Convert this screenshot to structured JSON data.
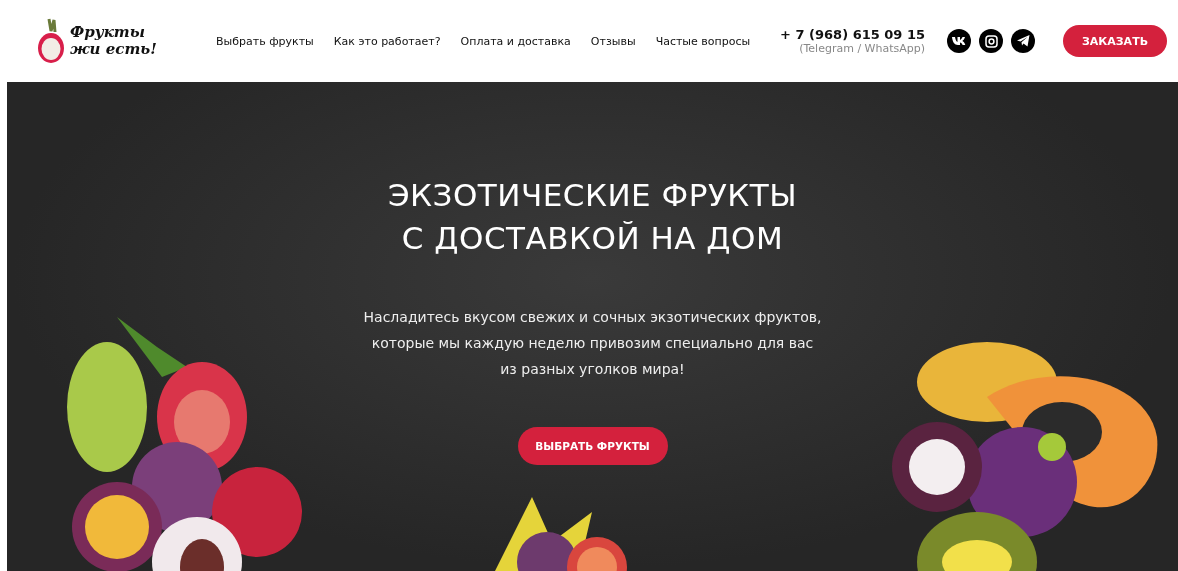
{
  "logo": {
    "lines": [
      "Фрукты",
      "жи есть!"
    ]
  },
  "nav": [
    {
      "label": "Выбрать фрукты"
    },
    {
      "label": "Как это работает?"
    },
    {
      "label": "Оплата и доставка"
    },
    {
      "label": "Отзывы"
    },
    {
      "label": "Частые вопросы"
    }
  ],
  "contact": {
    "phone": "+ 7 (968) 615 09 15",
    "note": "(Telegram / WhatsApp)"
  },
  "socials": [
    {
      "kind": "vk"
    },
    {
      "kind": "instagram"
    },
    {
      "kind": "telegram"
    }
  ],
  "order_button": "ЗАКАЗАТЬ",
  "hero": {
    "title_lines": [
      "ЭКЗОТИЧЕСКИЕ ФРУКТЫ",
      "С ДОСТАВКОЙ НА ДОМ"
    ],
    "description_lines": [
      "Насладитесь вкусом свежих и сочных экзотических фруктов,",
      "которые мы каждую неделю привозим специально для вас",
      "из разных уголков мира!"
    ],
    "button": "ВЫБРАТЬ ФРУКТЫ"
  }
}
